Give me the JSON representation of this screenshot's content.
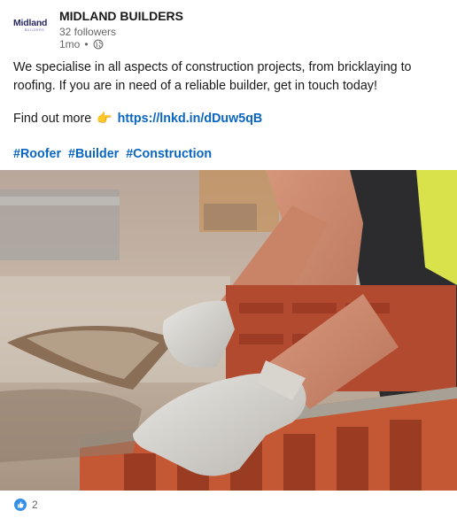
{
  "company": {
    "logo_text": "Midland",
    "logo_subtext": "BUILDERS",
    "name": "MIDLAND BUILDERS",
    "followers": "32 followers",
    "time": "1mo",
    "visibility_icon": "globe-icon"
  },
  "post": {
    "body": "We specialise in all aspects of construction projects, from bricklaying to roofing. If you are in need of a reliable builder, get in touch today!",
    "cta_prefix": "Find out more",
    "cta_emoji": "👉",
    "link": "https://lnkd.in/dDuw5qB",
    "hashtags": [
      "#Roofer",
      "#Builder",
      "#Construction"
    ]
  },
  "image": {
    "subject": "bricklayer-photo"
  },
  "reactions": {
    "icon": "like-icon",
    "count": "2"
  },
  "colors": {
    "link": "#0a66c2",
    "meta": "#666666",
    "text": "#191919",
    "like": "#378fe9"
  }
}
